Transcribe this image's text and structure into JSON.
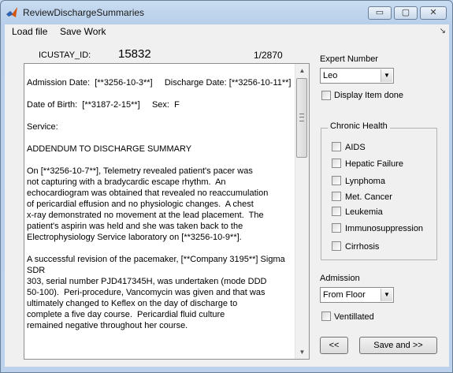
{
  "window": {
    "title": "ReviewDischargeSummaries",
    "controls": {
      "minimize": "▭",
      "maximize": "▢",
      "close": "✕"
    }
  },
  "menu": {
    "load_file": "Load file",
    "save_work": "Save Work",
    "arrow": "↘"
  },
  "header": {
    "icustay_label": "ICUSTAY_ID:",
    "icustay_value": "15832",
    "counter": "1/2870"
  },
  "summary_text": "\nAdmission Date:  [**3256-10-3**]     Discharge Date: [**3256-10-11**]\n\nDate of Birth:  [**3187-2-15**]     Sex:  F\n\nService:\n\nADDENDUM TO DISCHARGE SUMMARY\n\nOn [**3256-10-7**], Telemetry revealed patient's pacer was\nnot capturing with a bradycardic escape rhythm.  An\nechocardiogram was obtained that revealed no reaccumulation\nof pericardial effusion and no physiologic changes.  A chest\nx-ray demonstrated no movement at the lead placement.  The\npatient's aspirin was held and she was taken back to the\nElectrophysiology Service laboratory on [**3256-10-9**].\n\nA successful revision of the pacemaker, [**Company 3195**] Sigma\nSDR\n303, serial number PJD417345H, was undertaken (mode DDD\n50-100).  Peri-procedure, Vancomycin was given and that was\nultimately changed to Keflex on the day of discharge to\ncomplete a five day course.  Pericardial fluid culture\nremained negative throughout her course.",
  "expert": {
    "label": "Expert Number",
    "selected": "Leo",
    "display_done_label": "Display Item done"
  },
  "chronic_health": {
    "title": "Chronic Health",
    "items": [
      "AIDS",
      "Hepatic Failure",
      "Lynphoma",
      "Met. Cancer",
      "Leukemia",
      "Immunosuppression",
      "Cirrhosis"
    ]
  },
  "admission": {
    "label": "Admission",
    "selected": "From Floor",
    "ventilated_label": "Ventillated"
  },
  "buttons": {
    "prev": "<<",
    "save_next": "Save and >>"
  },
  "icons": {
    "app": "matlab-icon",
    "dropdown": "▼",
    "scroll_up": "▲",
    "scroll_down": "▼"
  }
}
